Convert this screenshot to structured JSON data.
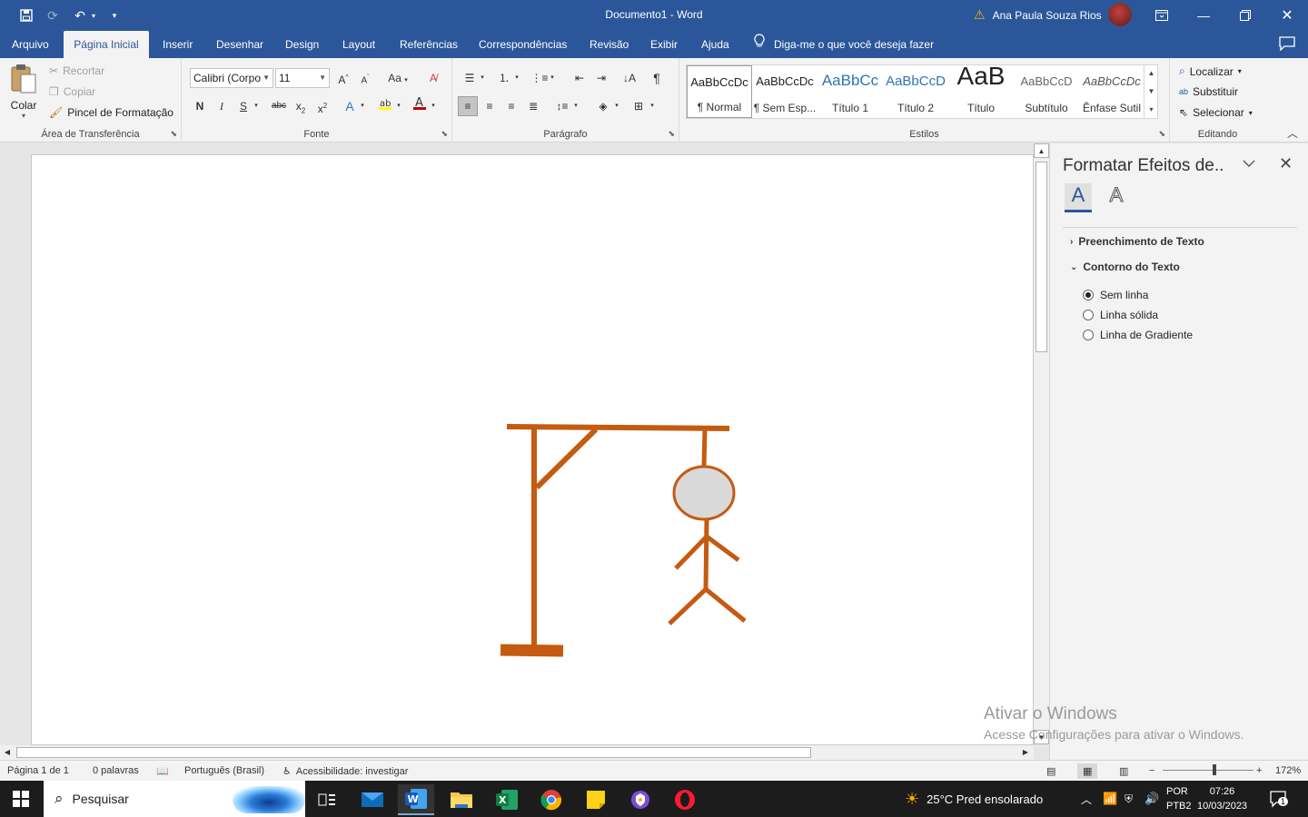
{
  "window": {
    "title": "Documento1  -  Word",
    "user_name": "Ana Paula Souza Rios"
  },
  "tabs": [
    {
      "label": "Arquivo"
    },
    {
      "label": "Página Inicial"
    },
    {
      "label": "Inserir"
    },
    {
      "label": "Desenhar"
    },
    {
      "label": "Design"
    },
    {
      "label": "Layout"
    },
    {
      "label": "Referências"
    },
    {
      "label": "Correspondências"
    },
    {
      "label": "Revisão"
    },
    {
      "label": "Exibir"
    },
    {
      "label": "Ajuda"
    }
  ],
  "tell_me": "Diga-me o que você deseja fazer",
  "ribbon": {
    "clipboard": {
      "label": "Área de Transferência",
      "paste": "Colar",
      "cut": "Recortar",
      "copy": "Copiar",
      "format_painter": "Pincel de Formatação"
    },
    "font": {
      "label": "Fonte",
      "font_name": "Calibri (Corpo",
      "font_size": "11"
    },
    "paragraph": {
      "label": "Parágrafo"
    },
    "styles": {
      "label": "Estilos",
      "items": [
        {
          "sample": "AaBbCcDc",
          "name": "¶ Normal"
        },
        {
          "sample": "AaBbCcDc",
          "name": "¶ Sem Esp..."
        },
        {
          "sample": "AaBbCc",
          "name": "Título 1"
        },
        {
          "sample": "AaBbCcD",
          "name": "Título 2"
        },
        {
          "sample": "AaB",
          "name": "Título"
        },
        {
          "sample": "AaBbCcD",
          "name": "Subtítulo"
        },
        {
          "sample": "AaBbCcDc",
          "name": "Ênfase Sutil"
        }
      ]
    },
    "editing": {
      "label": "Editando",
      "find": "Localizar",
      "replace": "Substituir",
      "select": "Selecionar"
    }
  },
  "task_pane": {
    "title": "Formatar Efeitos de..",
    "sections": {
      "fill": "Preenchimento de Texto",
      "outline": "Contorno do Texto"
    },
    "options": [
      {
        "label": "Sem linha",
        "selected": true
      },
      {
        "label": "Linha sólida",
        "selected": false
      },
      {
        "label": "Linha de Gradiente",
        "selected": false
      }
    ]
  },
  "drawing": {
    "stroke_color": "#c55a11",
    "head_fill": "#d9d9d9"
  },
  "watermark": {
    "line1": "Ativar o Windows",
    "line2": "Acesse Configurações para ativar o Windows."
  },
  "status": {
    "page": "Página 1 de 1",
    "words": "0 palavras",
    "language": "Português (Brasil)",
    "accessibility": "Acessibilidade: investigar",
    "zoom": "172%"
  },
  "taskbar": {
    "search_placeholder": "Pesquisar",
    "weather": "25°C  Pred ensolarado",
    "lang1": "POR",
    "lang2": "PTB2",
    "time": "07:26",
    "date": "10/03/2023",
    "notifications": "1"
  },
  "colors": {
    "accent": "#2b579a",
    "taskbar": "#1c1c1c"
  }
}
